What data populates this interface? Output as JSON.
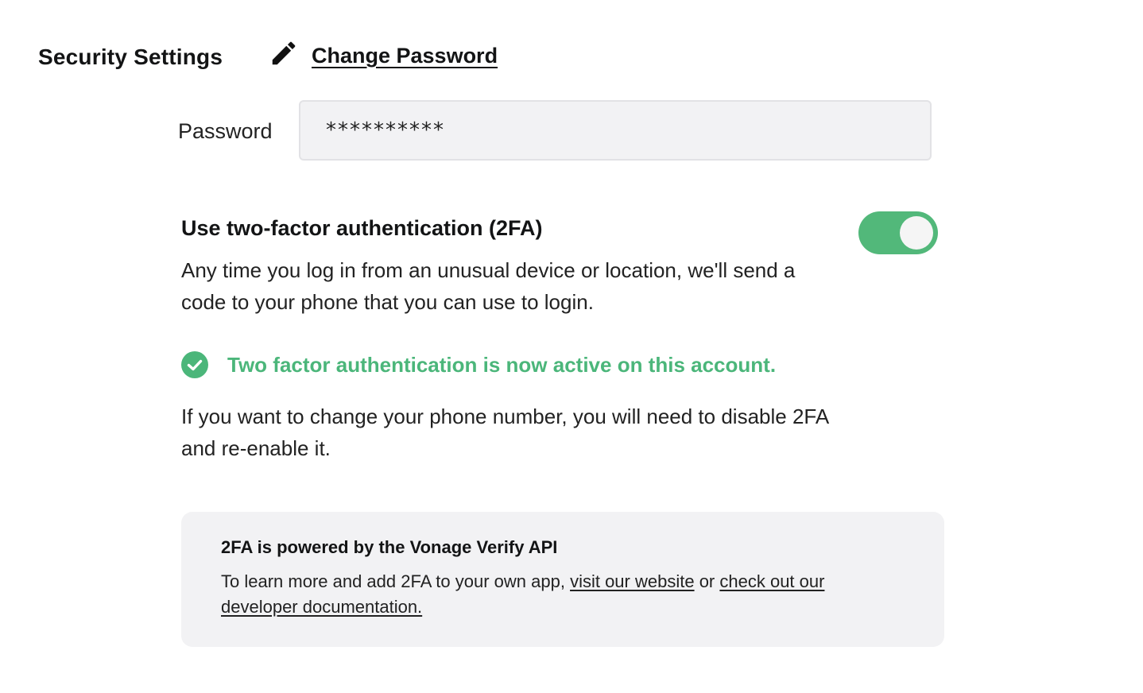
{
  "header": {
    "title": "Security Settings",
    "change_password_label": "Change Password",
    "change_password_icon": "pencil-icon"
  },
  "password": {
    "label": "Password",
    "value": "**********"
  },
  "two_factor": {
    "heading": "Use two-factor authentication (2FA)",
    "description": "Any time you log in from an unusual device or location, we'll send a code to your phone that you can use to login.",
    "toggle_on": true,
    "toggle_color": "#52b87a",
    "status_icon": "check-circle-icon",
    "status_text": "Two factor authentication is now active on this account.",
    "status_color": "#4bb67a",
    "phone_note": "If you want to change your phone number, you will need to disable 2FA and re-enable it."
  },
  "info_box": {
    "title": "2FA is powered by the Vonage Verify API",
    "text_before": "To learn more and add 2FA to your own app, ",
    "link_website": "visit our website",
    "text_between": " or ",
    "link_docs": "check out our developer documentation."
  }
}
